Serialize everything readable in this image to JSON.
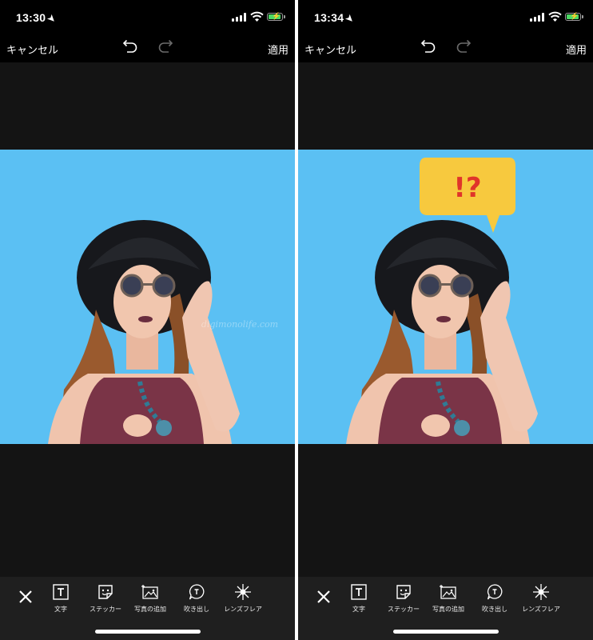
{
  "screens": [
    {
      "status": {
        "time": "13:30"
      },
      "nav": {
        "cancel": "キャンセル",
        "apply": "適用"
      },
      "bubble": null,
      "tools": [
        "文字",
        "ステッカー",
        "写真の追加",
        "吹き出し",
        "レンズフレア"
      ]
    },
    {
      "status": {
        "time": "13:34"
      },
      "nav": {
        "cancel": "キャンセル",
        "apply": "適用"
      },
      "bubble": {
        "text": "!?"
      },
      "tools": [
        "文字",
        "ステッカー",
        "写真の追加",
        "吹き出し",
        "レンズフレア"
      ]
    }
  ],
  "icons": [
    "location-arrow-icon",
    "signal-icon",
    "wifi-icon",
    "battery-icon",
    "undo-icon",
    "redo-icon",
    "close-icon",
    "text-icon",
    "sticker-icon",
    "add-photo-icon",
    "speech-bubble-icon",
    "lens-flare-icon"
  ],
  "colors": {
    "photo_background": "#5bc0f3",
    "bubble_fill": "#f7c93e",
    "bubble_text": "#e0342a",
    "battery": "#4cd964"
  }
}
